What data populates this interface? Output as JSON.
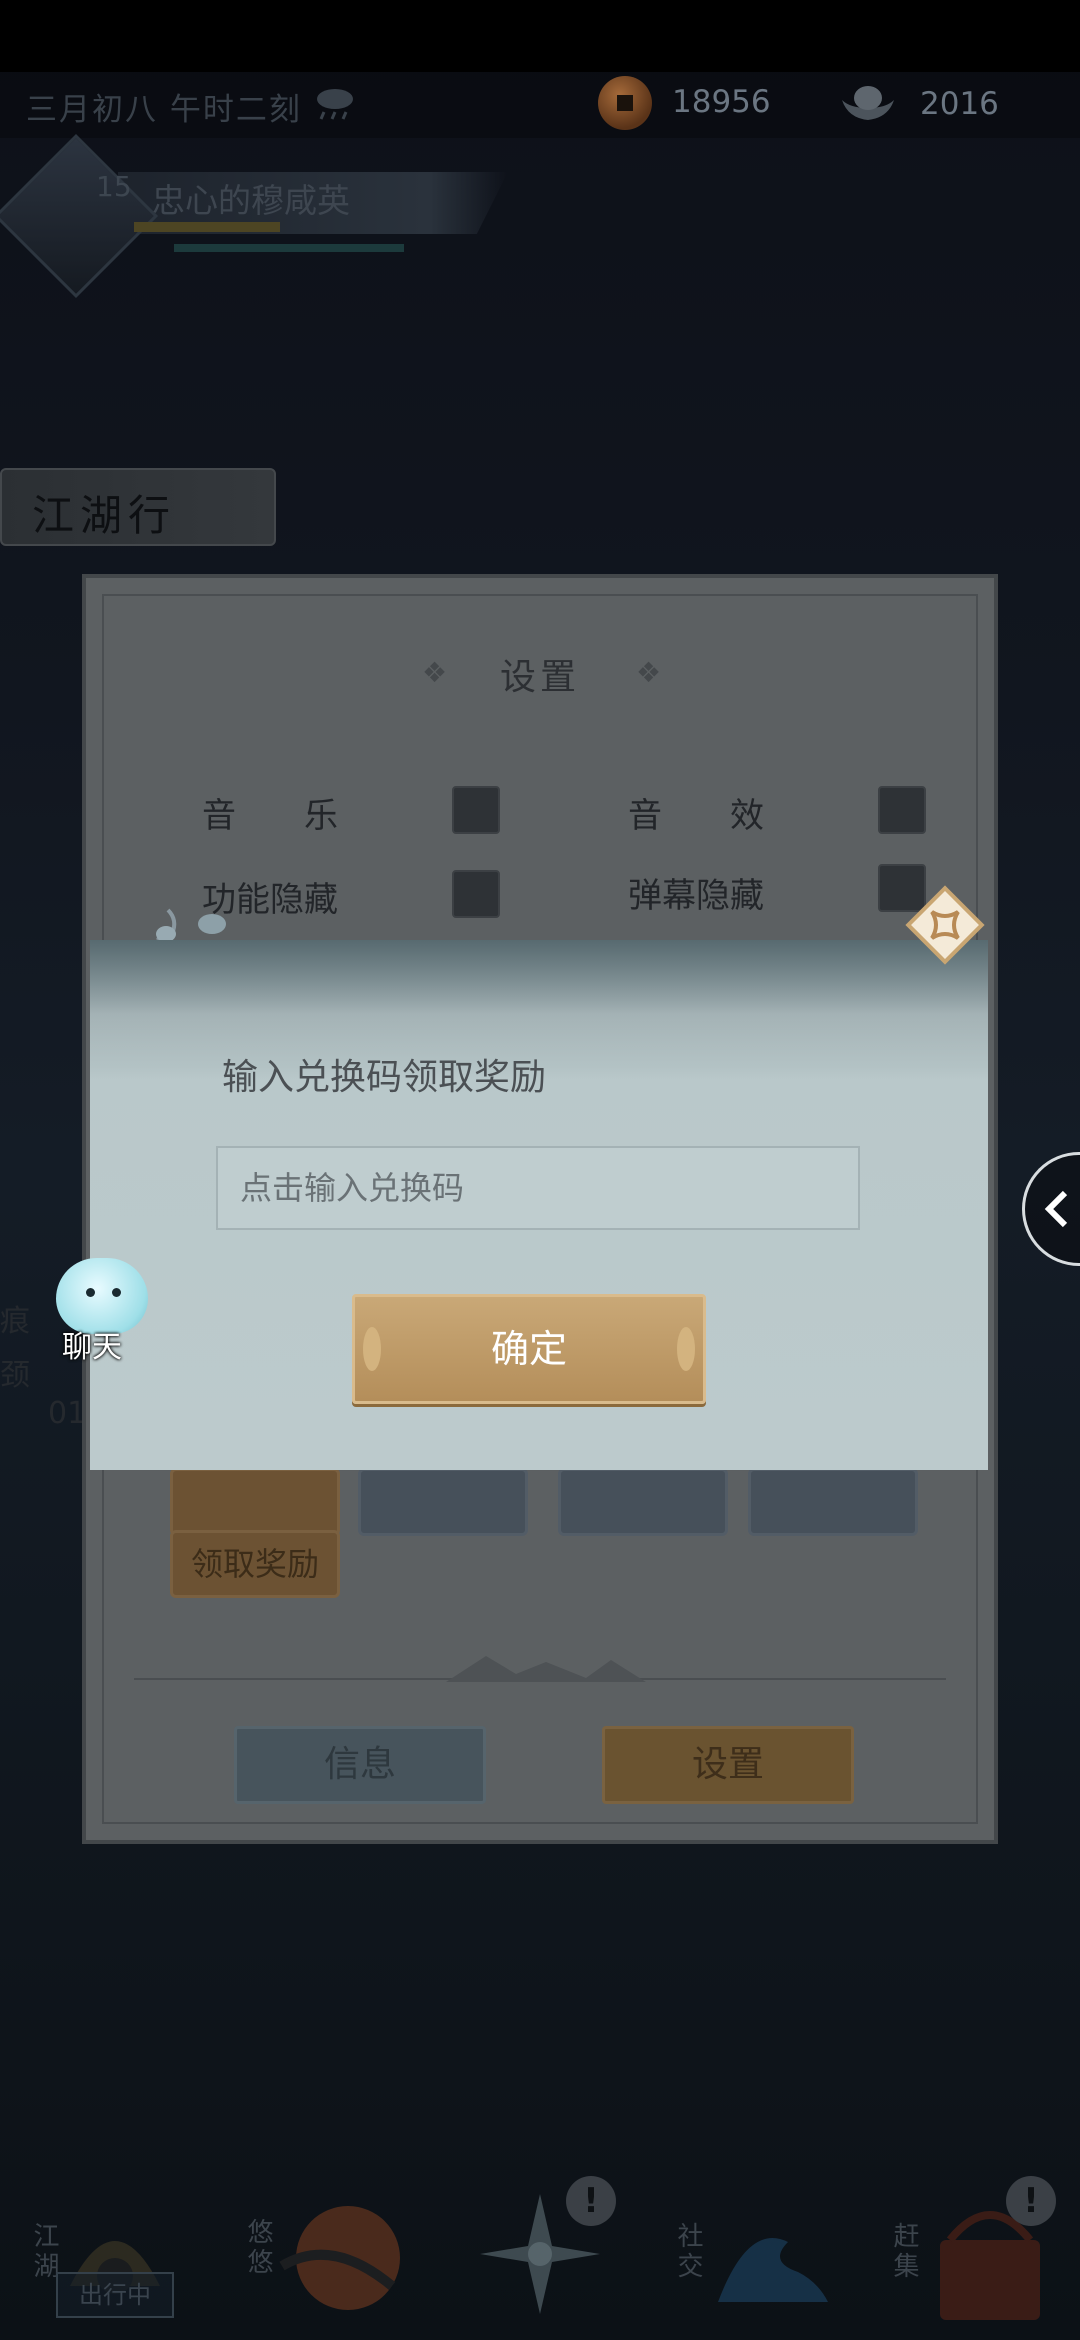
{
  "top_bar": {
    "date": "三月初八  午时二刻",
    "weather_icon": "cloud-rain-icon",
    "copper_coins": "18956",
    "silver_ingots": "2016"
  },
  "player": {
    "level": "15",
    "name": "忠心的穆咸英"
  },
  "left_banner": {
    "label": "江湖行"
  },
  "settings": {
    "title": "设置",
    "options": {
      "music": "音　　乐",
      "sound_effects": "音　　效",
      "hide_functions": "功能隐藏",
      "hide_danmaku": "弹幕隐藏"
    },
    "claim_button": "领取奖励",
    "tabs": {
      "info": "信息",
      "settings": "设置"
    }
  },
  "redeem_dialog": {
    "prompt": "输入兑换码领取奖励",
    "input_placeholder": "点击输入兑换码",
    "confirm_button": "确定"
  },
  "chat": {
    "label": "聊天"
  },
  "bottom_nav": {
    "jianghu": "江湖",
    "outing_tag": "出行中",
    "youyou": "悠悠",
    "social": "社交",
    "market": "赶集",
    "badge": "!"
  },
  "colors": {
    "confirm_button": "#b48e5a",
    "dialog_bg": "#bccacc",
    "panel_bg": "#5c6062"
  }
}
